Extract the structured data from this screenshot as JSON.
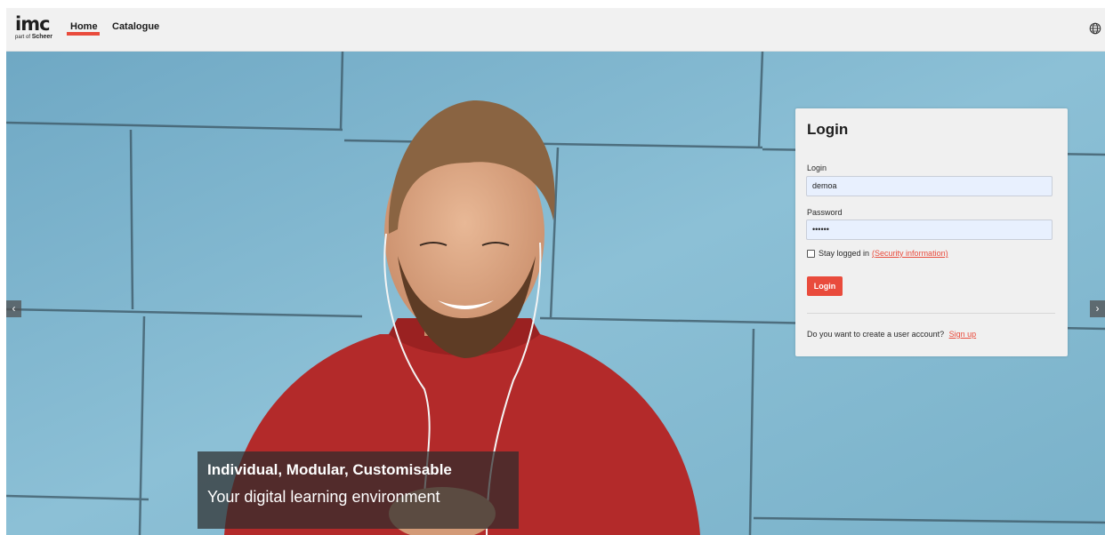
{
  "brand": {
    "logo_main": "imc",
    "logo_sub_small": "part of",
    "logo_sub_bold": "Scheer"
  },
  "nav": {
    "items": [
      {
        "label": "Home"
      },
      {
        "label": "Catalogue"
      }
    ]
  },
  "icons": {
    "language": "globe-icon",
    "prev": "chevron-left-icon",
    "next": "chevron-right-icon"
  },
  "carousel": {
    "prev_symbol": "‹",
    "next_symbol": "›"
  },
  "login": {
    "title": "Login",
    "login_label": "Login",
    "login_value": "demoa",
    "password_label": "Password",
    "password_value": "••••••",
    "stay_logged_in": "Stay logged in",
    "security_link": "(Security information)",
    "button": "Login",
    "signup_prompt": "Do you want to create a user account?",
    "signup_link": "Sign up"
  },
  "hero": {
    "title": "Individual, Modular, Customisable",
    "subtitle": "Your digital learning environment"
  },
  "colors": {
    "accent": "#e94b3c",
    "topbar": "#f1f1f1",
    "card": "#f0f0f0",
    "input": "#e8f0fe"
  }
}
